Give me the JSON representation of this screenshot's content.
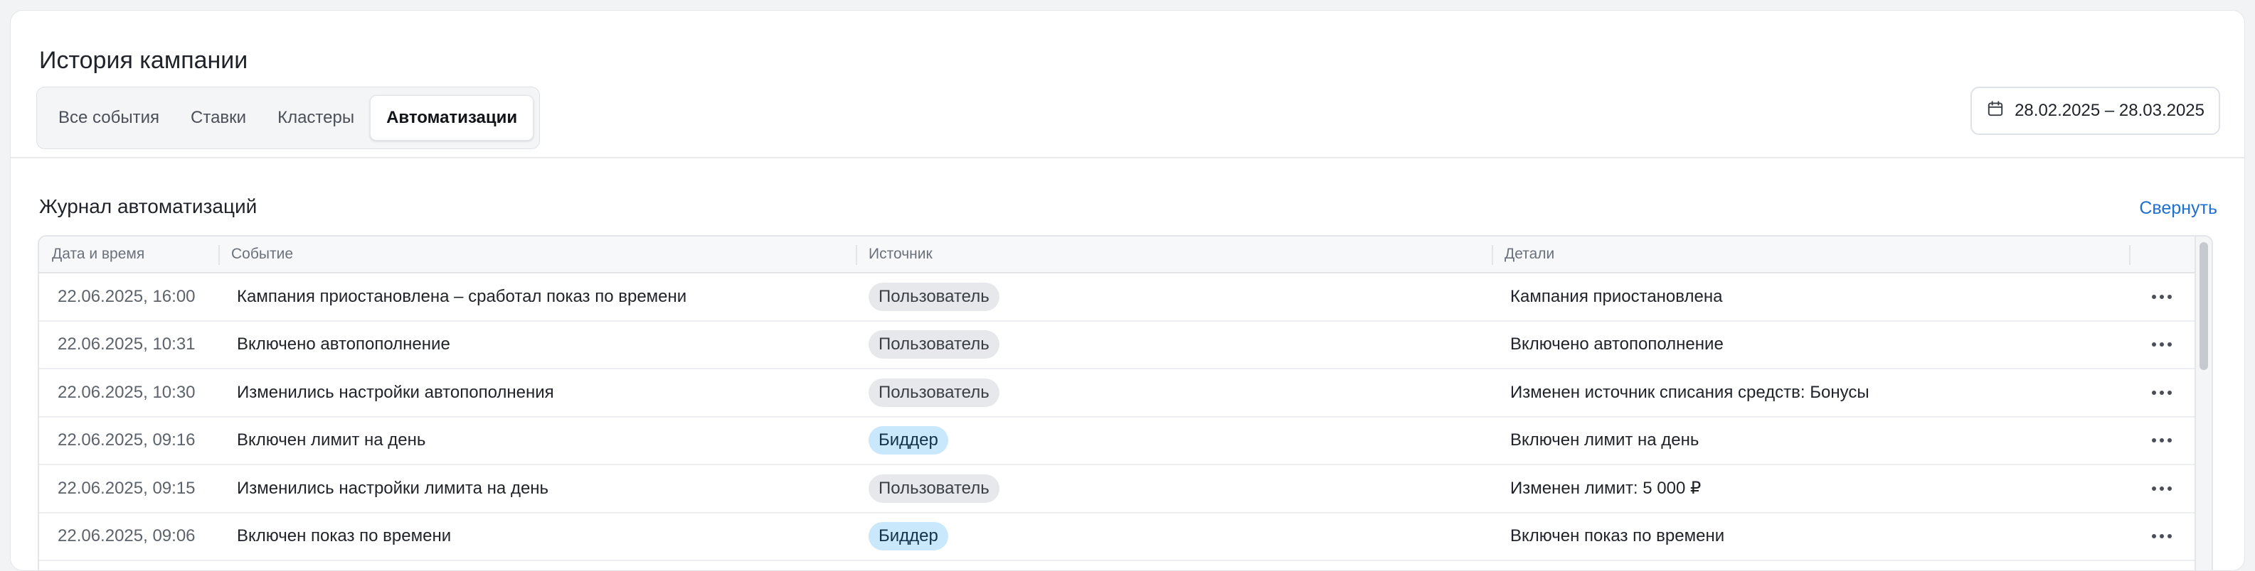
{
  "header": {
    "title": "История кампании",
    "tabs": [
      "Все события",
      "Ставки",
      "Кластеры",
      "Автоматизации"
    ],
    "active_tab": "Автоматизации",
    "date_range": "28.02.2025 – 28.03.2025"
  },
  "section": {
    "title": "Журнал автоматизаций",
    "collapse_label": "Свернуть"
  },
  "table": {
    "columns": [
      "Дата и время",
      "Событие",
      "Источник",
      "Детали"
    ],
    "rows": [
      {
        "datetime": "22.06.2025, 16:00",
        "event": "Кампания приостановлена – сработал показ по времени",
        "source": "Пользователь",
        "source_type": "user",
        "details": "Кампания приостановлена"
      },
      {
        "datetime": "22.06.2025, 10:31",
        "event": "Включено автопополнение",
        "source": "Пользователь",
        "source_type": "user",
        "details": "Включено автопополнение"
      },
      {
        "datetime": "22.06.2025, 10:30",
        "event": "Изменились настройки автопополнения",
        "source": "Пользователь",
        "source_type": "user",
        "details": "Изменен источник списания средств: Бонусы"
      },
      {
        "datetime": "22.06.2025, 09:16",
        "event": "Включен лимит на день",
        "source": "Биддер",
        "source_type": "bidder",
        "details": "Включен лимит на день"
      },
      {
        "datetime": "22.06.2025, 09:15",
        "event": "Изменились настройки лимита на день",
        "source": "Пользователь",
        "source_type": "user",
        "details": "Изменен лимит: 5 000 ₽"
      },
      {
        "datetime": "22.06.2025, 09:06",
        "event": "Включен показ по времени",
        "source": "Биддер",
        "source_type": "bidder",
        "details": "Включен показ по времени"
      }
    ]
  },
  "colors": {
    "accent_link": "#1d6fd1",
    "badge_user_bg": "#e7e8eb",
    "badge_bidder_bg": "#c9e8fb"
  },
  "icons": {
    "date_picker": "calendar-icon",
    "row_actions": "more-horizontal-icon"
  }
}
